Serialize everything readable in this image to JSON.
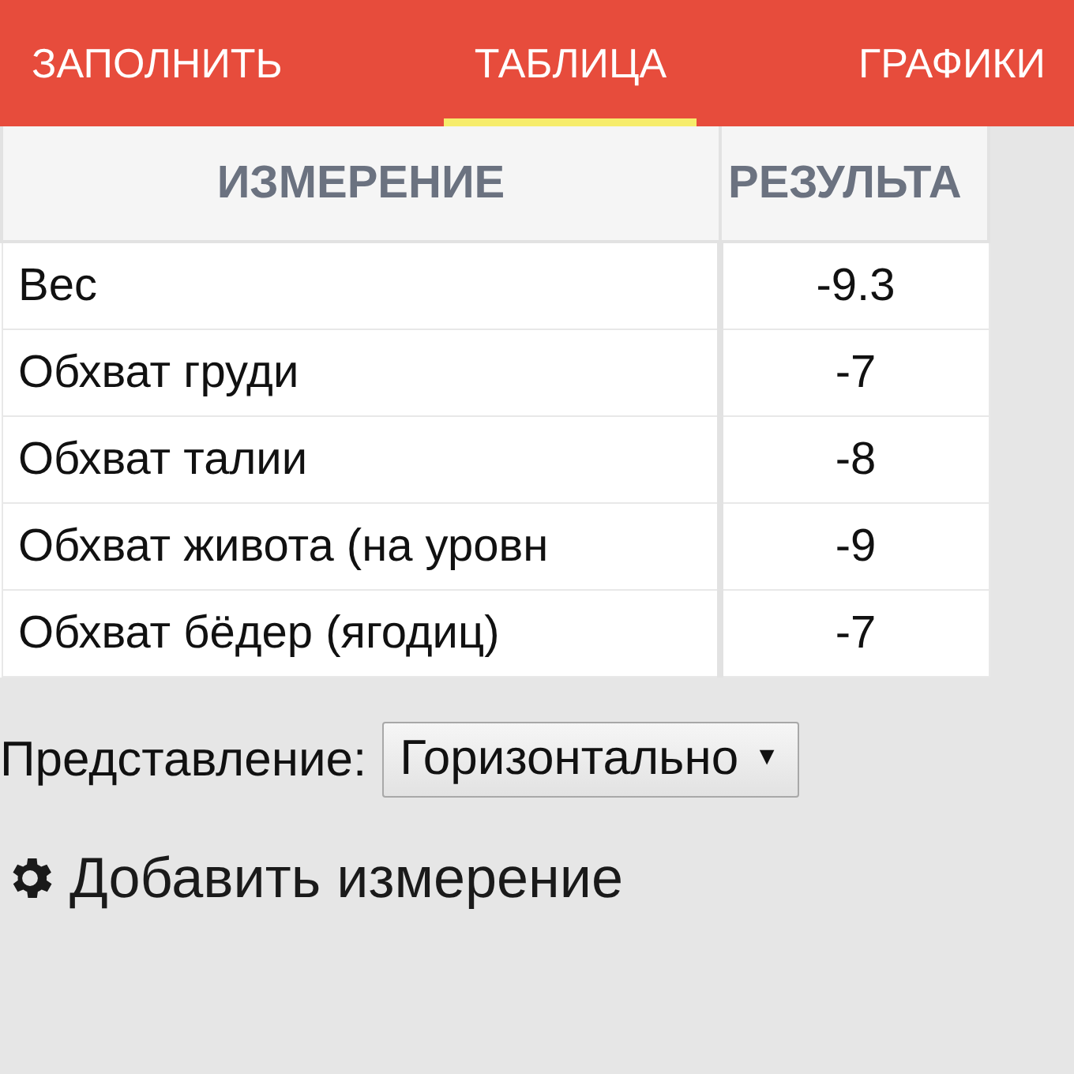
{
  "tabs": [
    {
      "label": "ЗАПОЛНИТЬ",
      "selected": false
    },
    {
      "label": "ТАБЛИЦА",
      "selected": true
    },
    {
      "label": "ГРАФИКИ",
      "selected": false
    }
  ],
  "table": {
    "columns": [
      "ИЗМЕРЕНИЕ",
      "РЕЗУЛЬТА"
    ],
    "rows": [
      [
        "Вес",
        "-9.3"
      ],
      [
        "Обхват груди",
        "-7"
      ],
      [
        "Обхват талии",
        "-8"
      ],
      [
        "Обхват живота (на уровн",
        "-9"
      ],
      [
        "Обхват бёдер (ягодиц)",
        "-7"
      ]
    ]
  },
  "view": {
    "label": "Представление:",
    "value": "Горизонтально",
    "arrow": "▼"
  },
  "add_button": {
    "label": "Добавить измерение"
  }
}
